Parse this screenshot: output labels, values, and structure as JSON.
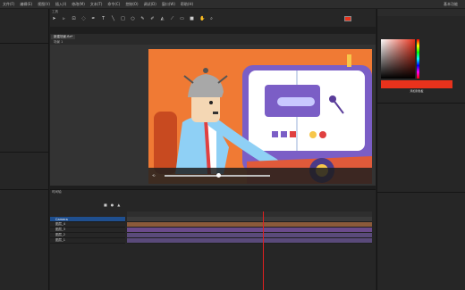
{
  "menu": {
    "items": [
      "文件(F)",
      "编辑(E)",
      "视图(V)",
      "插入(I)",
      "修改(M)",
      "文本(T)",
      "命令(C)",
      "控制(O)",
      "调试(D)",
      "窗口(W)",
      "帮助(H)"
    ],
    "workspace": "基本功能"
  },
  "toolbar": {
    "title": "工具",
    "tools": [
      "arrow-tool",
      "subselect-tool",
      "transform-tool",
      "lasso-tool",
      "pen-tool",
      "text-tool",
      "line-tool",
      "rect-tool",
      "oval-tool",
      "pencil-tool",
      "brush-tool",
      "paint-bucket-tool",
      "eyedropper-tool",
      "eraser-tool",
      "camera-tool",
      "hand-tool",
      "zoom-tool"
    ]
  },
  "stage": {
    "tab_label": "新建场景.fla*",
    "breadcrumb": "场景 1"
  },
  "timeline": {
    "tab_label": "时间轴",
    "layers": [
      {
        "name": "Camera",
        "selected": true
      },
      {
        "name": "图层_4",
        "selected": false
      },
      {
        "name": "图层_3",
        "selected": false
      },
      {
        "name": "图层_2",
        "selected": false
      },
      {
        "name": "图层_1",
        "selected": false
      }
    ]
  },
  "color_panel": {
    "current_color": "#e8321c",
    "add_swatch_label": "添加到色板"
  },
  "colors": {
    "accent": "#e8321c",
    "selection": "#1f4f8f",
    "playhead": "#e02020"
  }
}
